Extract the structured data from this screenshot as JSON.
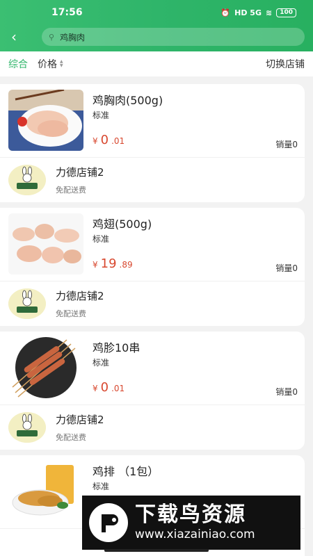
{
  "status_bar": {
    "time": "17:56",
    "signal_label": "HD 5G",
    "battery": "100"
  },
  "search": {
    "query": "鸡胸肉"
  },
  "filters": {
    "comprehensive": "综合",
    "price": "价格",
    "switch_store": "切换店铺"
  },
  "colors": {
    "accent": "#2fb56a",
    "price": "#d8482f"
  },
  "products": [
    {
      "name": "鸡胸肉(500g)",
      "spec": "标准",
      "price_yuan": "¥",
      "price_int": "0",
      "price_dec": ".01",
      "sales": "销量0",
      "store_name": "力德店铺2",
      "store_tag": "免配送费"
    },
    {
      "name": "鸡翅(500g)",
      "spec": "标准",
      "price_yuan": "¥",
      "price_int": "19",
      "price_dec": ".89",
      "sales": "销量0",
      "store_name": "力德店铺2",
      "store_tag": "免配送费"
    },
    {
      "name": "鸡胗10串",
      "spec": "标准",
      "price_yuan": "¥",
      "price_int": "0",
      "price_dec": ".01",
      "sales": "销量0",
      "store_name": "力德店铺2",
      "store_tag": "免配送费"
    },
    {
      "name": "鸡排 （1包）",
      "spec": "标准"
    }
  ],
  "watermark": {
    "title": "下载鸟资源",
    "url": "www.xiazainiao.com"
  }
}
